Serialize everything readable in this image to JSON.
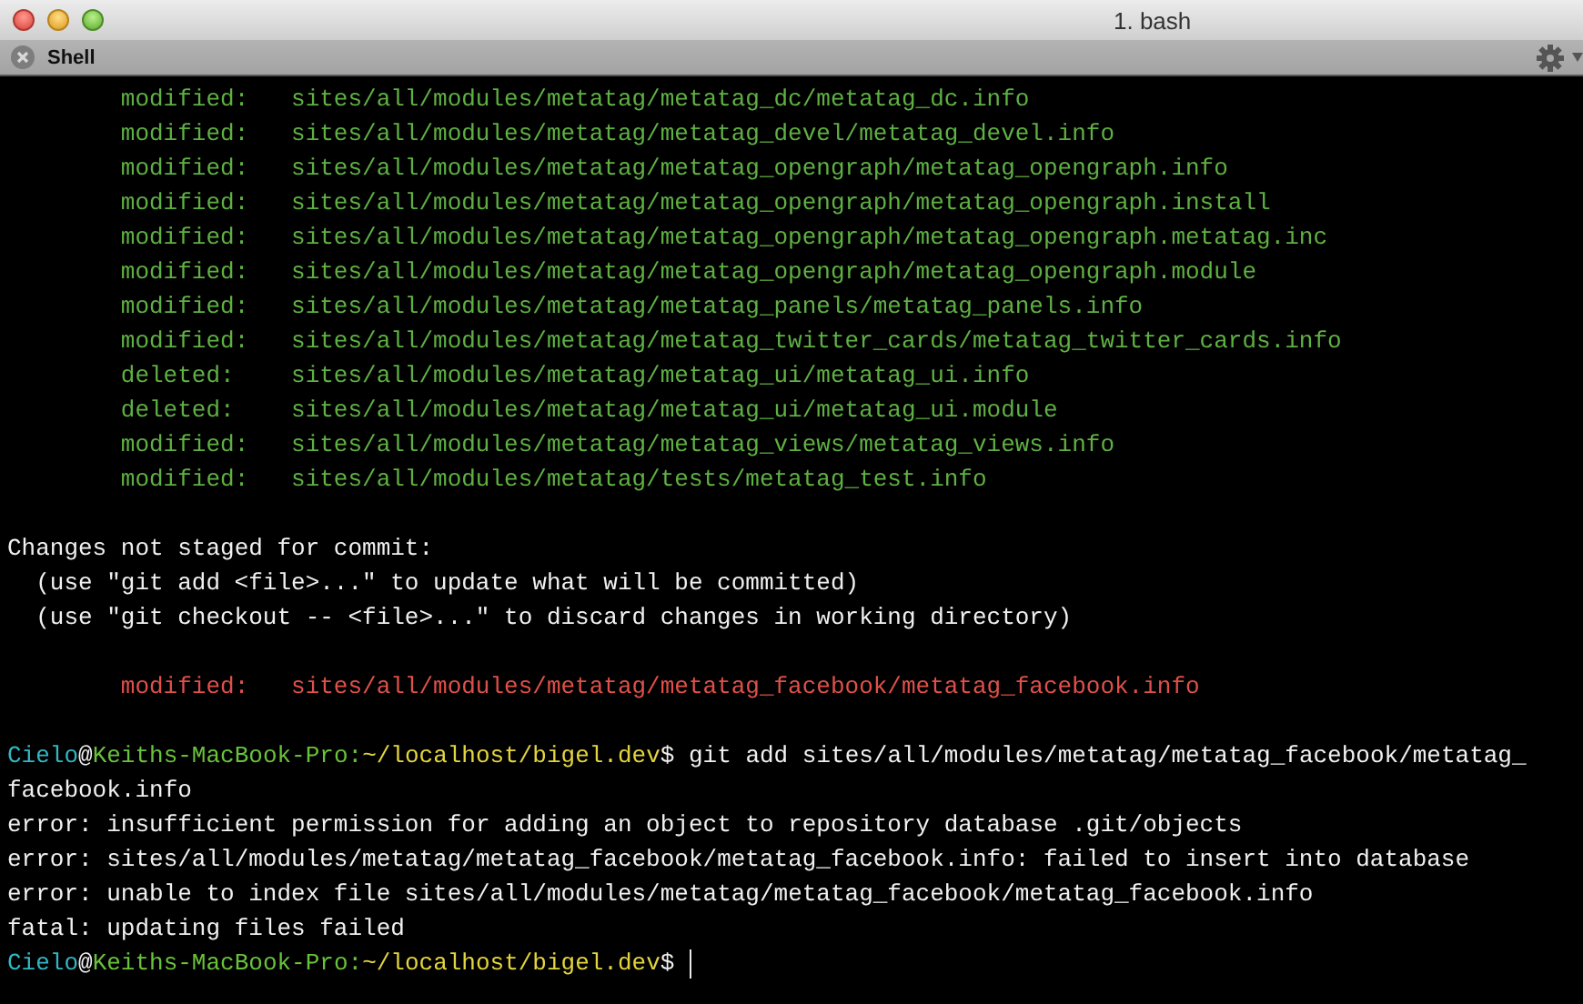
{
  "window": {
    "title": "1. bash"
  },
  "tab": {
    "label": "Shell"
  },
  "lines": [
    {
      "kind": "staged",
      "status": "modified:",
      "path": "sites/all/modules/metatag/metatag_dc/metatag_dc.info"
    },
    {
      "kind": "staged",
      "status": "modified:",
      "path": "sites/all/modules/metatag/metatag_devel/metatag_devel.info"
    },
    {
      "kind": "staged",
      "status": "modified:",
      "path": "sites/all/modules/metatag/metatag_opengraph/metatag_opengraph.info"
    },
    {
      "kind": "staged",
      "status": "modified:",
      "path": "sites/all/modules/metatag/metatag_opengraph/metatag_opengraph.install"
    },
    {
      "kind": "staged",
      "status": "modified:",
      "path": "sites/all/modules/metatag/metatag_opengraph/metatag_opengraph.metatag.inc"
    },
    {
      "kind": "staged",
      "status": "modified:",
      "path": "sites/all/modules/metatag/metatag_opengraph/metatag_opengraph.module"
    },
    {
      "kind": "staged",
      "status": "modified:",
      "path": "sites/all/modules/metatag/metatag_panels/metatag_panels.info"
    },
    {
      "kind": "staged",
      "status": "modified:",
      "path": "sites/all/modules/metatag/metatag_twitter_cards/metatag_twitter_cards.info"
    },
    {
      "kind": "staged",
      "status": "deleted:",
      "path": "sites/all/modules/metatag/metatag_ui/metatag_ui.info"
    },
    {
      "kind": "staged",
      "status": "deleted:",
      "path": "sites/all/modules/metatag/metatag_ui/metatag_ui.module"
    },
    {
      "kind": "staged",
      "status": "modified:",
      "path": "sites/all/modules/metatag/metatag_views/metatag_views.info"
    },
    {
      "kind": "staged",
      "status": "modified:",
      "path": "sites/all/modules/metatag/tests/metatag_test.info"
    },
    {
      "kind": "blank"
    },
    {
      "kind": "text",
      "text": "Changes not staged for commit:"
    },
    {
      "kind": "hint",
      "text": "(use \"git add <file>...\" to update what will be committed)"
    },
    {
      "kind": "hint",
      "text": "(use \"git checkout -- <file>...\" to discard changes in working directory)"
    },
    {
      "kind": "blank"
    },
    {
      "kind": "unstaged",
      "status": "modified:",
      "path": "sites/all/modules/metatag/metatag_facebook/metatag_facebook.info"
    },
    {
      "kind": "blank"
    },
    {
      "kind": "prompt",
      "user": "Cielo",
      "at": "@",
      "host": "Keiths-MacBook-Pro:",
      "path": "~/localhost/bigel.dev",
      "symbol": "$",
      "command": "git add sites/all/modules/metatag/metatag_facebook/metatag_"
    },
    {
      "kind": "text",
      "text": "facebook.info"
    },
    {
      "kind": "text",
      "text": "error: insufficient permission for adding an object to repository database .git/objects"
    },
    {
      "kind": "text",
      "text": "error: sites/all/modules/metatag/metatag_facebook/metatag_facebook.info: failed to insert into database"
    },
    {
      "kind": "text",
      "text": "error: unable to index file sites/all/modules/metatag/metatag_facebook/metatag_facebook.info"
    },
    {
      "kind": "text",
      "text": "fatal: updating files failed"
    },
    {
      "kind": "prompt",
      "user": "Cielo",
      "at": "@",
      "host": "Keiths-MacBook-Pro:",
      "path": "~/localhost/bigel.dev",
      "symbol": "$",
      "cursor": true
    }
  ]
}
